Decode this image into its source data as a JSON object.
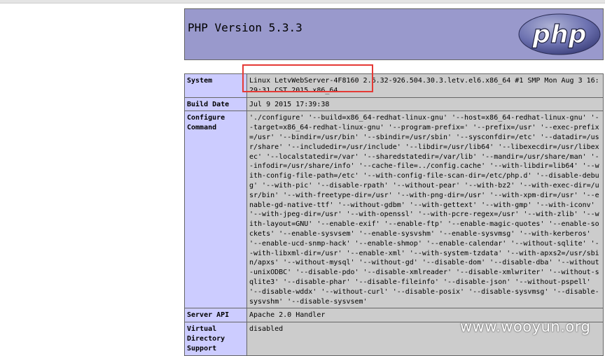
{
  "header": {
    "title": "PHP Version 5.3.3",
    "logo_text": "php"
  },
  "rows": [
    {
      "label": "System",
      "value": "Linux LetvWebServer-4F8160 2.6.32-926.504.30.3.letv.el6.x86_64 #1 SMP Mon Aug 3 16:29:31 CST 2015 x86_64"
    },
    {
      "label": "Build Date",
      "value": "Jul 9 2015 17:39:38"
    },
    {
      "label": "Configure Command",
      "value": "'./configure' '--build=x86_64-redhat-linux-gnu' '--host=x86_64-redhat-linux-gnu' '--target=x86_64-redhat-linux-gnu' '--program-prefix=' '--prefix=/usr' '--exec-prefix=/usr' '--bindir=/usr/bin' '--sbindir=/usr/sbin' '--sysconfdir=/etc' '--datadir=/usr/share' '--includedir=/usr/include' '--libdir=/usr/lib64' '--libexecdir=/usr/libexec' '--localstatedir=/var' '--sharedstatedir=/var/lib' '--mandir=/usr/share/man' '--infodir=/usr/share/info' '--cache-file=../config.cache' '--with-libdir=lib64' '--with-config-file-path=/etc' '--with-config-file-scan-dir=/etc/php.d' '--disable-debug' '--with-pic' '--disable-rpath' '--without-pear' '--with-bz2' '--with-exec-dir=/usr/bin' '--with-freetype-dir=/usr' '--with-png-dir=/usr' '--with-xpm-dir=/usr' '--enable-gd-native-ttf' '--without-gdbm' '--with-gettext' '--with-gmp' '--with-iconv' '--with-jpeg-dir=/usr' '--with-openssl' '--with-pcre-regex=/usr' '--with-zlib' '--with-layout=GNU' '--enable-exif' '--enable-ftp' '--enable-magic-quotes' '--enable-sockets' '--enable-sysvsem' '--enable-sysvshm' '--enable-sysvmsg' '--with-kerberos' '--enable-ucd-snmp-hack' '--enable-shmop' '--enable-calendar' '--without-sqlite' '--with-libxml-dir=/usr' '--enable-xml' '--with-system-tzdata' '--with-apxs2=/usr/sbin/apxs' '--without-mysql' '--without-gd' '--disable-dom' '--disable-dba' '--without-unixODBC' '--disable-pdo' '--disable-xmlreader' '--disable-xmlwriter' '--without-sqlite3' '--disable-phar' '--disable-fileinfo' '--disable-json' '--without-pspell' '--disable-wddx' '--without-curl' '--disable-posix' '--disable-sysvmsg' '--disable-sysvshm' '--disable-sysvsem'"
    },
    {
      "label": "Server API",
      "value": "Apache 2.0 Handler"
    },
    {
      "label": "Virtual Directory Support",
      "value": "disabled"
    }
  ],
  "watermark": "www.wooyun.org",
  "colors": {
    "header_bg": "#9999cc",
    "label_bg": "#ccccff",
    "value_bg": "#cccccc",
    "highlight": "#e53935"
  }
}
